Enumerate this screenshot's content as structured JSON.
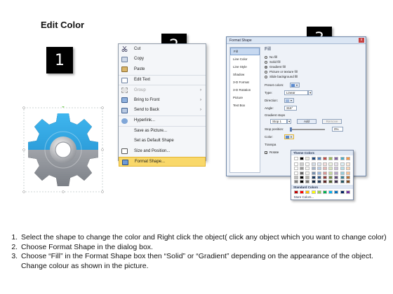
{
  "title": "Edit Color",
  "badges": {
    "one": "1",
    "two": "2",
    "three": "3"
  },
  "colors": {
    "gear_blue": "#29a3df",
    "gear_gray": "#9fa2a8",
    "highlight": "#f9d86a",
    "dialog_bg": "#eef2f8"
  },
  "context_menu": {
    "items": [
      {
        "label": "Cut",
        "icon": "scissors-icon",
        "disabled": false
      },
      {
        "label": "Copy",
        "icon": "copy-icon",
        "disabled": false
      },
      {
        "label": "Paste",
        "icon": "paste-icon",
        "disabled": false
      },
      {
        "label": "Edit Text",
        "icon": "edit-text-icon",
        "disabled": false
      },
      {
        "label": "Group",
        "icon": "group-icon",
        "disabled": true,
        "submenu": true
      },
      {
        "label": "Bring to Front",
        "icon": "bring-to-front-icon",
        "disabled": false,
        "submenu": true
      },
      {
        "label": "Send to Back",
        "icon": "send-to-back-icon",
        "disabled": false,
        "submenu": true
      },
      {
        "label": "Hyperlink...",
        "icon": "hyperlink-icon",
        "disabled": false
      },
      {
        "label": "Save as Picture...",
        "icon": "",
        "disabled": false
      },
      {
        "label": "Set as Default Shape",
        "icon": "",
        "disabled": false
      },
      {
        "label": "Size and Position...",
        "icon": "size-position-icon",
        "disabled": false
      },
      {
        "label": "Format Shape...",
        "icon": "format-shape-icon",
        "disabled": false,
        "highlight": true
      }
    ]
  },
  "dialog": {
    "title": "Format Shape",
    "close_label": "x",
    "nav": [
      "Fill",
      "Line Color",
      "Line Style",
      "Shadow",
      "3-D Format",
      "3-D Rotation",
      "Picture",
      "Text Box"
    ],
    "heading": "Fill",
    "options": [
      {
        "label": "No fill",
        "selected": false
      },
      {
        "label": "Solid fill",
        "selected": false
      },
      {
        "label": "Gradient fill",
        "selected": true
      },
      {
        "label": "Picture or texture fill",
        "selected": false
      },
      {
        "label": "Slide background fill",
        "selected": false
      }
    ],
    "preset_label": "Preset colors:",
    "type_label": "Type:",
    "type_value": "Linear",
    "direction_label": "Direction:",
    "angle_label": "Angle:",
    "angle_value": "315°",
    "stops_label": "Gradient stops",
    "stop_value": "Stop 1",
    "add_label": "Add",
    "remove_label": "Remove",
    "stop_position_label": "Stop position:",
    "stop_position_value": "0%",
    "color_label": "Color:",
    "transparency_label": "Transpa",
    "rotate_label": "Rotate"
  },
  "palette": {
    "theme_heading": "Theme Colors",
    "standard_heading": "Standard Colors",
    "more_label": "More Colors...",
    "theme_top": [
      "#ffffff",
      "#000000",
      "#eeece1",
      "#1f497d",
      "#4f81bd",
      "#c0504d",
      "#9bbb59",
      "#8064a2",
      "#4bacc6",
      "#f79646"
    ],
    "standard": [
      "#c00000",
      "#ff0000",
      "#ffc000",
      "#ffff00",
      "#92d050",
      "#00b050",
      "#00b0f0",
      "#0070c0",
      "#002060",
      "#7030a0"
    ]
  },
  "instructions": [
    "Select the shape to change the color and Right click the object( click any object which you want to change color)",
    "Choose Format Shape in the dialog box.",
    "Choose “Fill” in the Format Shape box then “Solid” or “Gradient” depending on the appearance of the object. Change colour as shown in the picture."
  ]
}
